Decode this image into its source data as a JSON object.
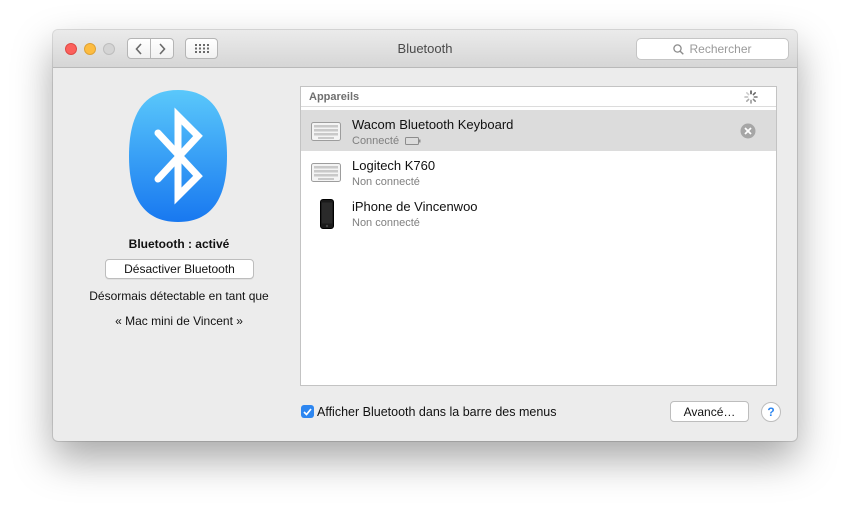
{
  "window": {
    "title": "Bluetooth",
    "search_placeholder": "Rechercher"
  },
  "sidebar": {
    "status": "Bluetooth : activé",
    "toggle_label": "Désactiver Bluetooth",
    "discoverable_line1": "Désormais détectable en tant que",
    "discoverable_line2": "« Mac mini de Vincent »"
  },
  "devices": {
    "header": "Appareils",
    "items": [
      {
        "name": "Wacom Bluetooth Keyboard",
        "status": "Connecté",
        "icon": "keyboard-icon",
        "selected": true
      },
      {
        "name": "Logitech K760",
        "status": "Non connecté",
        "icon": "keyboard-icon",
        "selected": false
      },
      {
        "name": "iPhone de Vincenwoo",
        "status": "Non connecté",
        "icon": "iphone-icon",
        "selected": false
      }
    ]
  },
  "footer": {
    "menu_checkbox_label": "Afficher Bluetooth dans la barre des menus",
    "menu_checkbox_checked": true,
    "advanced_label": "Avancé…",
    "help_label": "?"
  },
  "colors": {
    "accent": "#2d86f0",
    "bluetooth_logo_top": "#5ac8fb",
    "bluetooth_logo_bottom": "#1878f0",
    "selected_row": "#dcdcdc"
  }
}
